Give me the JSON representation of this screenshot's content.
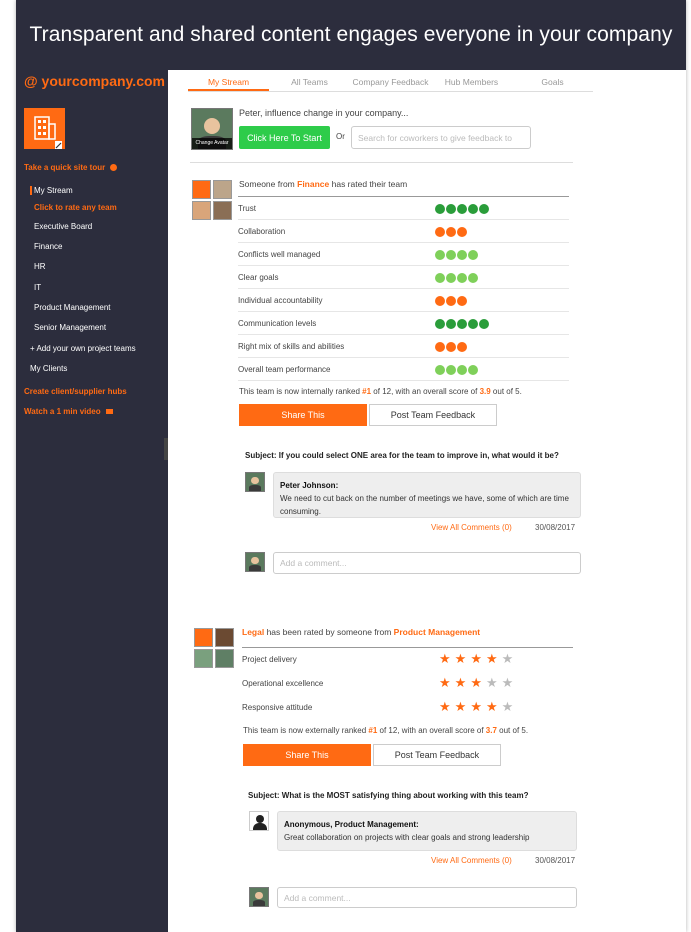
{
  "headline": "Transparent and shared content engages everyone in your company",
  "sidebar": {
    "brand": "@ yourcompany.com",
    "tour": "Take a quick site tour",
    "items": [
      "My Stream",
      "Click to rate any team",
      "Executive Board",
      "Finance",
      "HR",
      "IT",
      "Product Management",
      "Senior Management",
      "+ Add your own project teams",
      "My Clients"
    ],
    "create_hubs": "Create client/supplier hubs",
    "video": "Watch a 1 min video"
  },
  "tabs": [
    "My Stream",
    "All Teams",
    "Company Feedback",
    "Hub Members",
    "Goals"
  ],
  "influence": {
    "prompt": "Peter, influence change in your company...",
    "start_button": "Click Here To Start",
    "or": "Or",
    "search_placeholder": "Search for coworkers to give feedback to",
    "avatar_caption": "Change Avatar"
  },
  "post1": {
    "title_pre": "Someone from ",
    "title_team": "Finance",
    "title_post": " has rated their team",
    "ratings": [
      {
        "label": "Trust",
        "score": 5,
        "color": "#2a9d3a"
      },
      {
        "label": "Collaboration",
        "score": 3,
        "color": "#ff6a13"
      },
      {
        "label": "Conflicts well managed",
        "score": 4,
        "color": "#7fd05a"
      },
      {
        "label": "Clear goals",
        "score": 4,
        "color": "#7fd05a"
      },
      {
        "label": "Individual accountability",
        "score": 3,
        "color": "#ff6a13"
      },
      {
        "label": "Communication levels",
        "score": 5,
        "color": "#2a9d3a"
      },
      {
        "label": "Right mix of skills and abilities",
        "score": 3,
        "color": "#ff6a13"
      },
      {
        "label": "Overall team performance",
        "score": 4,
        "color": "#7fd05a"
      }
    ],
    "rank_pre": "This team is now internally ranked ",
    "rank": "#1",
    "rank_mid": " of 12, with an overall score of ",
    "score": "3.9",
    "rank_post": " out of 5.",
    "share": "Share This",
    "post_feedback": "Post Team Feedback",
    "subject": "Subject: If you could select ONE area for the team to improve in, what would it be?",
    "comment_author": "Peter Johnson:",
    "comment_text": "We need to cut back on the number of meetings we have, some of which are time consuming.",
    "view_all": "View All Comments (0)",
    "date": "30/08/2017",
    "add_comment": "Add a comment..."
  },
  "post2": {
    "team": "Legal",
    "title_mid": " has been rated by someone from ",
    "from_team": "Product Management",
    "ratings": [
      {
        "label": "Project delivery",
        "stars": 4
      },
      {
        "label": "Operational excellence",
        "stars": 3
      },
      {
        "label": "Responsive attitude",
        "stars": 4
      }
    ],
    "rank_pre": "This team is now externally ranked ",
    "rank": "#1",
    "rank_mid": " of 12, with an overall score of ",
    "score": "3.7",
    "rank_post": " out of 5.",
    "share": "Share This",
    "post_feedback": "Post Team Feedback",
    "subject": "Subject: What is the MOST satisfying thing about working with this team?",
    "comment_author": "Anonymous, Product Management:",
    "comment_text": "Great collaboration on projects with clear goals and strong leadership",
    "view_all": "View All Comments (0)",
    "date": "30/08/2017",
    "add_comment": "Add a comment..."
  },
  "colors": {
    "accent": "#ff6a13",
    "dark": "#2c2d3d",
    "green": "#2ecc4a"
  }
}
